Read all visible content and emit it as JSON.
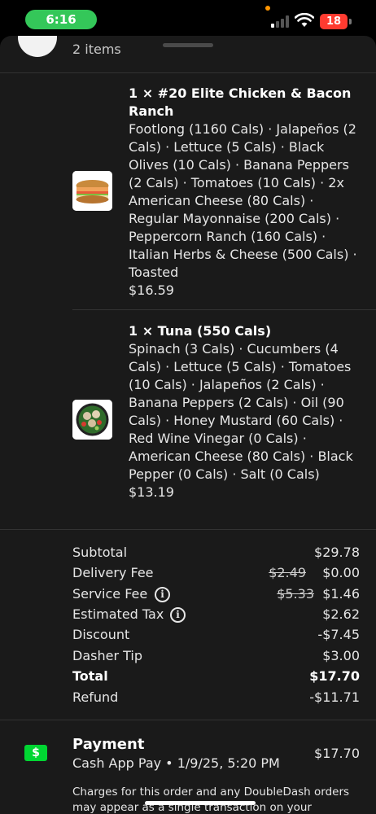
{
  "status_bar": {
    "time": "6:16",
    "battery": "18"
  },
  "order": {
    "items_count_label": "2 items",
    "items": [
      {
        "title": "1 × #20 Elite Chicken & Bacon Ranch",
        "details": "Footlong (1160 Cals) · Jalapeños (2 Cals) · Lettuce (5 Cals) · Black Olives (10 Cals) · Banana Peppers (2 Cals) · Tomatoes (10 Cals) · 2x American Cheese (80 Cals) · Regular Mayonnaise (200 Cals) · Peppercorn Ranch (160 Cals) · Italian Herbs & Cheese (500 Cals) · Toasted",
        "price": "$16.59",
        "image": "sandwich-photo"
      },
      {
        "title": "1 × Tuna (550 Cals)",
        "details": "Spinach (3 Cals) · Cucumbers (4 Cals) · Lettuce (5 Cals) · Tomatoes (10 Cals) · Jalapeños (2 Cals) · Banana Peppers (2 Cals) · Oil (90 Cals) · Honey Mustard (60 Cals) · Red Wine Vinegar (0 Cals) · American Cheese (80 Cals) · Black Pepper (0 Cals) · Salt (0 Cals)",
        "price": "$13.19",
        "image": "salad-bowl-photo"
      }
    ]
  },
  "summary": {
    "subtotal": {
      "label": "Subtotal",
      "value": "$29.78"
    },
    "delivery_fee": {
      "label": "Delivery Fee",
      "original": "$2.49",
      "value": "$0.00"
    },
    "service_fee": {
      "label": "Service Fee",
      "original": "$5.33",
      "value": "$1.46",
      "info_icon": "i"
    },
    "estimated_tax": {
      "label": "Estimated Tax",
      "value": "$2.62",
      "info_icon": "i"
    },
    "discount": {
      "label": "Discount",
      "value": "-$7.45"
    },
    "dasher_tip": {
      "label": "Dasher Tip",
      "value": "$3.00"
    },
    "total": {
      "label": "Total",
      "value": "$17.70"
    },
    "refund": {
      "label": "Refund",
      "value": "-$11.71"
    }
  },
  "payment": {
    "icon_glyph": "$",
    "title": "Payment",
    "method": "Cash App Pay • 1/9/25, 5:20 PM",
    "amount": "$17.70",
    "note": "Charges for this order and any DoubleDash orders may appear as a single transaction on your statement."
  },
  "colors": {
    "sheet_bg": "#1a1a1a",
    "cash_app_green": "#00d632",
    "status_green": "#34c759",
    "battery_red": "#ff3b30"
  }
}
